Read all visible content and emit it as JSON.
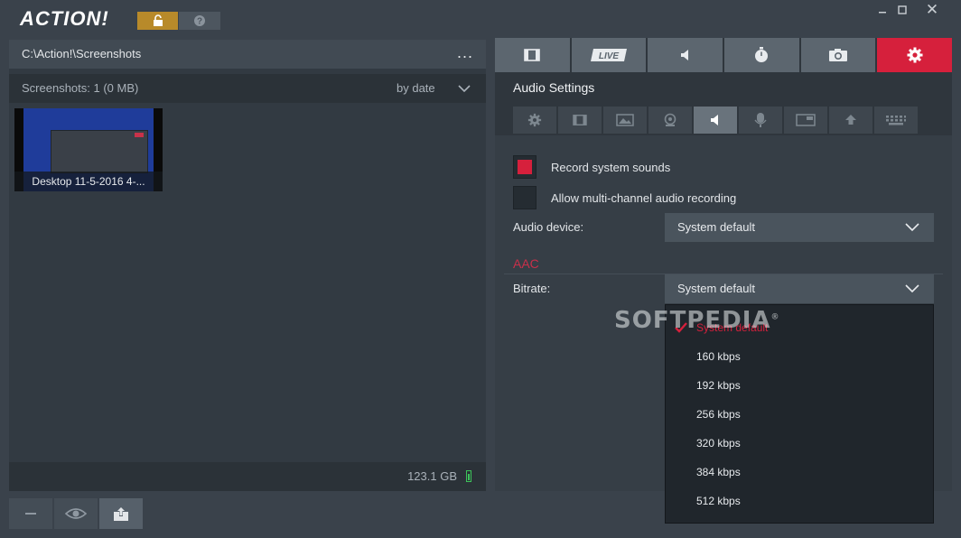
{
  "app": {
    "logo": "ACTION!",
    "window_minimize": "minimize",
    "window_maximize": "maximize",
    "window_close": "✕"
  },
  "colors": {
    "accent": "#d6203c",
    "lock": "#b88a2a",
    "panel": "#2f363d",
    "storage_ok": "#3dc35a"
  },
  "left": {
    "path": "C:\\Action!\\Screenshots",
    "more": "...",
    "count": "Screenshots: 1 (0 MB)",
    "sort": "by date",
    "items": [
      {
        "caption": "Desktop 11-5-2016 4-..."
      }
    ],
    "disk_free": "123.1 GB",
    "bottom_buttons": [
      "minus-icon",
      "eye-icon",
      "export-icon"
    ]
  },
  "tabs": [
    {
      "name": "video",
      "icon": "film-icon",
      "label": ""
    },
    {
      "name": "live",
      "icon": "live-icon",
      "label": "LIVE"
    },
    {
      "name": "audio",
      "icon": "speaker-icon",
      "label": ""
    },
    {
      "name": "benchmark",
      "icon": "stopwatch-icon",
      "label": ""
    },
    {
      "name": "screenshot",
      "icon": "camera-icon",
      "label": ""
    },
    {
      "name": "settings",
      "icon": "gear-icon",
      "label": "",
      "active": true
    }
  ],
  "settings": {
    "title": "Audio Settings",
    "subtabs": [
      "gear-icon",
      "film-icon",
      "image-icon",
      "webcam-icon",
      "speaker-icon",
      "microphone-icon",
      "window-icon",
      "upload-icon",
      "keyboard-icon"
    ],
    "active_subtab": 4,
    "record_system_sounds": {
      "label": "Record system sounds",
      "checked": true
    },
    "multichannel": {
      "label": "Allow multi-channel audio recording",
      "checked": false
    },
    "audio_device": {
      "label": "Audio device:",
      "value": "System default"
    },
    "aac_title": "AAC",
    "bitrate": {
      "label": "Bitrate:",
      "value": "System default",
      "options": [
        "System default",
        "160 kbps",
        "192 kbps",
        "256 kbps",
        "320 kbps",
        "384 kbps",
        "512 kbps"
      ],
      "selected": 0
    }
  },
  "watermark": {
    "text": "SOFTPEDIA",
    "mark": "®"
  }
}
